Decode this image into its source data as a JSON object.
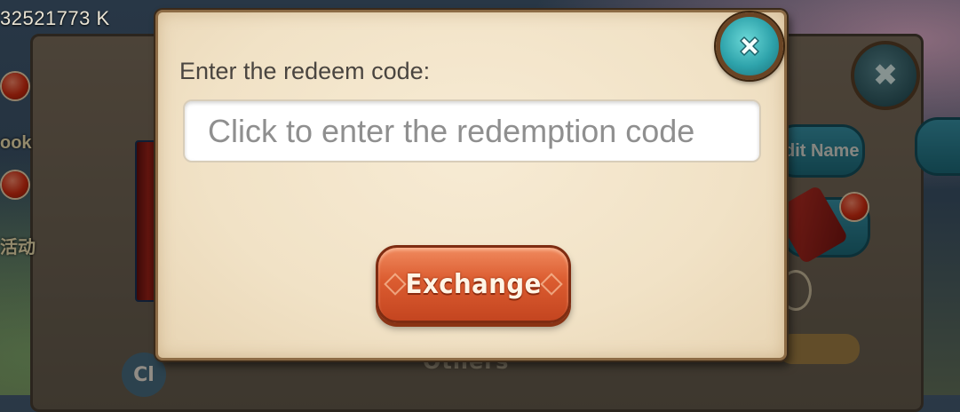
{
  "background": {
    "account_id_text": "32521773 K",
    "side_labels": [
      "ook",
      "活动"
    ],
    "edit_name_label": "dit Name",
    "others_label": "Others",
    "bottom_button_label": "Cl"
  },
  "dialog": {
    "prompt": "Enter the redeem code:",
    "code_input": {
      "value": "",
      "placeholder": "Click to enter the redemption code"
    },
    "exchange_button_label": "Exchange",
    "close_icon": "close-x-icon"
  },
  "colors": {
    "dialog_bg": "#f1e2c6",
    "exchange_button": "#db5c30",
    "close_button": "#2ea3ab",
    "dialog_border": "#8c6b45"
  }
}
